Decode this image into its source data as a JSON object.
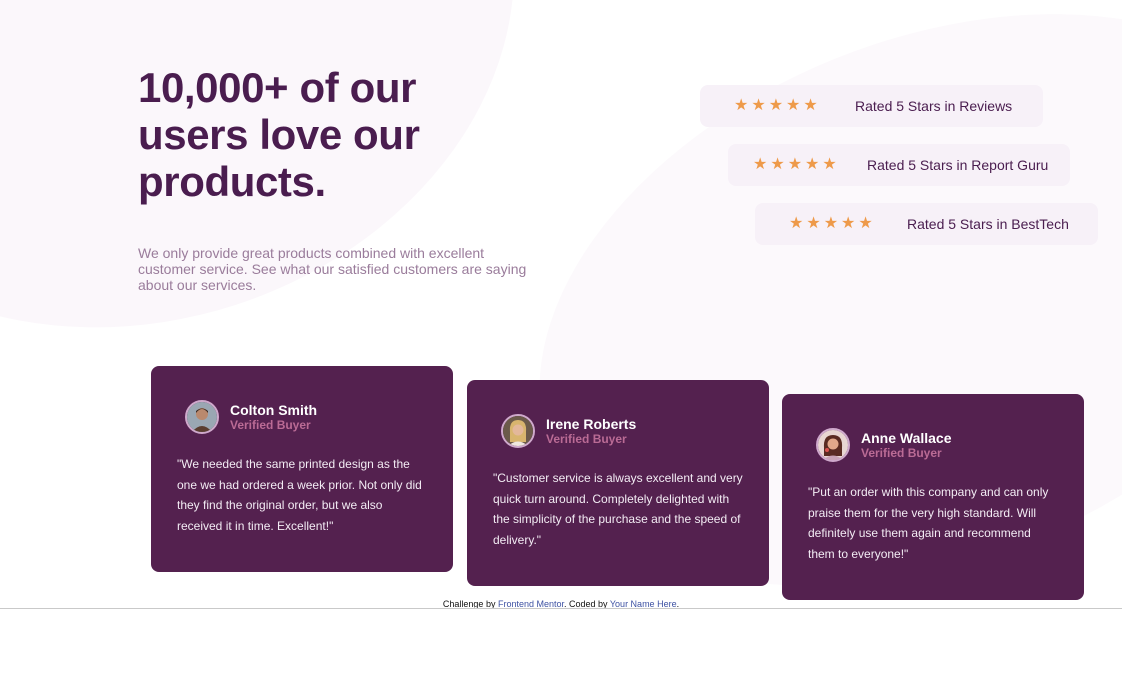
{
  "hero": {
    "title_line1": "10,000+ of our",
    "title_line2": "users love our",
    "title_line3": "products.",
    "description": "We only provide great products combined with excellent customer service. See what our satisfied customers are saying about our services."
  },
  "ratings": [
    {
      "stars": 5,
      "label": "Rated 5 Stars in Reviews"
    },
    {
      "stars": 5,
      "label": "Rated 5 Stars in Report Guru"
    },
    {
      "stars": 5,
      "label": "Rated 5 Stars in BestTech"
    }
  ],
  "testimonials": [
    {
      "name": "Colton Smith",
      "role": "Verified Buyer",
      "quote": "\"We needed the same printed design as the one we had ordered a week prior. Not only did they find the original order, but we also received it in time. Excellent!\""
    },
    {
      "name": "Irene Roberts",
      "role": "Verified Buyer",
      "quote": "\"Customer service is always excellent and very quick turn around. Completely delighted with the simplicity of the purchase and the speed of delivery.\""
    },
    {
      "name": "Anne Wallace",
      "role": "Verified Buyer",
      "quote": "\"Put an order with this company and can only praise them for the very high standard. Will definitely use them again and recommend them to everyone!\""
    }
  ],
  "footer": {
    "prefix": "Challenge by ",
    "challenge_link": "Frontend Mentor",
    "middle": ". Coded by ",
    "coder_link": "Your Name Here",
    "suffix": "."
  },
  "colors": {
    "primary": "#4a1d4f",
    "card": "#54214f",
    "accent": "#ba6b95",
    "star": "#ee9a4a",
    "chip": "#f7f1f8"
  }
}
